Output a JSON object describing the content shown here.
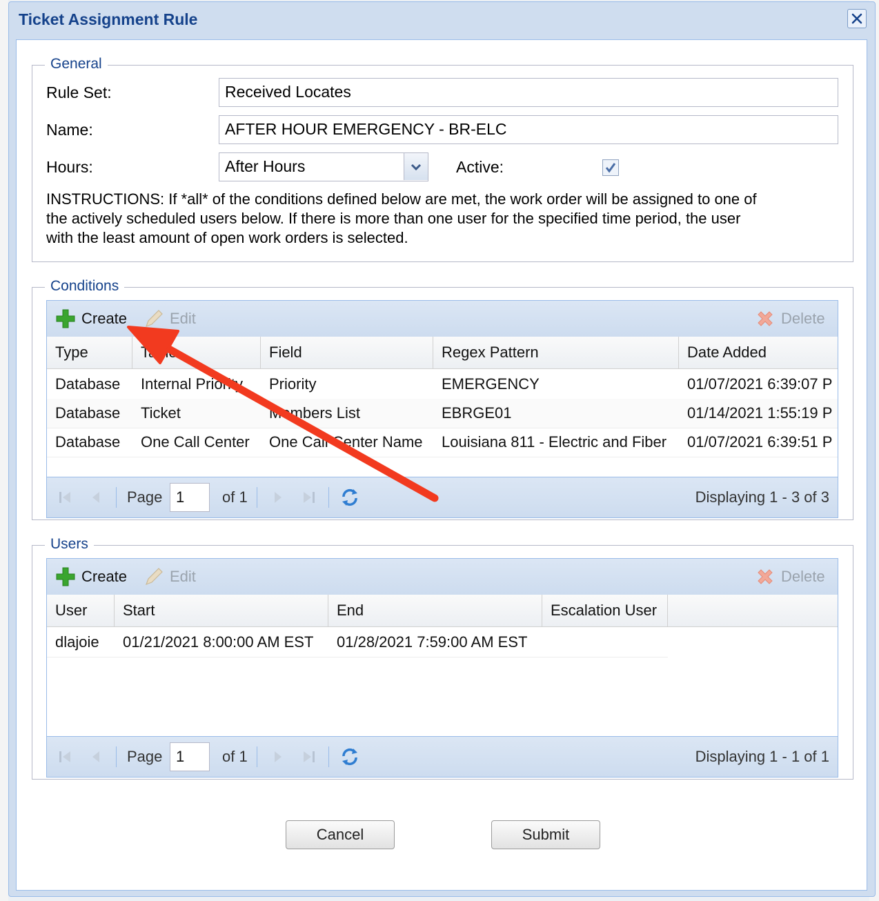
{
  "window": {
    "title": "Ticket Assignment Rule"
  },
  "general": {
    "legend": "General",
    "rule_set_label": "Rule Set:",
    "rule_set_value": "Received Locates",
    "name_label": "Name:",
    "name_value": "AFTER HOUR EMERGENCY - BR-ELC",
    "hours_label": "Hours:",
    "hours_value": "After Hours",
    "active_label": "Active:",
    "active_checked": true,
    "instructions": [
      "INSTRUCTIONS: If *all* of the conditions defined below are met, the work order will be assigned to one of",
      "the actively scheduled users below. If there is more than one user for the specified time period, the user",
      "with the least amount of open work orders is selected."
    ]
  },
  "conditions": {
    "legend": "Conditions",
    "toolbar": {
      "create": "Create",
      "edit": "Edit",
      "delete": "Delete"
    },
    "columns": [
      "Type",
      "Table",
      "Field",
      "Regex Pattern",
      "Date Added"
    ],
    "rows": [
      [
        "Database",
        "Internal Priority",
        "Priority",
        "EMERGENCY",
        "01/07/2021 6:39:07 P"
      ],
      [
        "Database",
        "Ticket",
        "Members List",
        "EBRGE01",
        "01/14/2021 1:55:19 P"
      ],
      [
        "Database",
        "One Call Center",
        "One Call Center Name",
        "Louisiana 811 - Electric and Fiber",
        "01/07/2021 6:39:51 P"
      ]
    ],
    "pager": {
      "page_label": "Page",
      "page_value": "1",
      "of_label": "of 1",
      "displaying": "Displaying 1 - 3 of 3"
    }
  },
  "users": {
    "legend": "Users",
    "toolbar": {
      "create": "Create",
      "edit": "Edit",
      "delete": "Delete"
    },
    "columns": [
      "User",
      "Start",
      "End",
      "Escalation User",
      ""
    ],
    "rows": [
      [
        "dlajoie",
        "01/21/2021 8:00:00 AM EST",
        "01/28/2021 7:59:00 AM EST",
        ""
      ]
    ],
    "pager": {
      "page_label": "Page",
      "page_value": "1",
      "of_label": "of 1",
      "displaying": "Displaying 1 - 1 of 1"
    }
  },
  "footer": {
    "cancel": "Cancel",
    "submit": "Submit"
  },
  "colors": {
    "title": "#15428b",
    "annotation_arrow": "#f23a1f",
    "window_frame": "#cfddef"
  },
  "icons": [
    "close-icon",
    "chevron-down-icon",
    "checkmark-icon",
    "plus-icon",
    "pencil-icon",
    "x-icon",
    "first-page-icon",
    "prev-page-icon",
    "next-page-icon",
    "last-page-icon",
    "refresh-icon"
  ]
}
